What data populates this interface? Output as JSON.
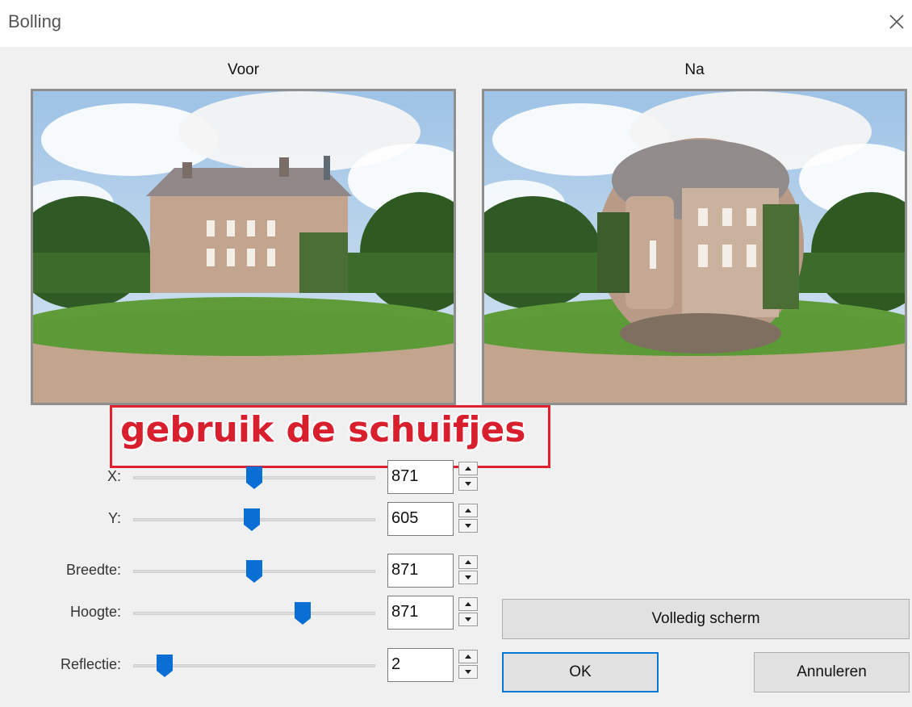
{
  "window": {
    "title": "Bolling",
    "close_icon": "close-icon"
  },
  "previews": {
    "before_label": "Voor",
    "after_label": "Na"
  },
  "annotation": {
    "text": "gebruik de schuifjes",
    "color": "#d81f2e"
  },
  "controls": [
    {
      "id": "x",
      "label": "X:",
      "value": "871",
      "slider_fraction": 0.5
    },
    {
      "id": "y",
      "label": "Y:",
      "value": "605",
      "slider_fraction": 0.49
    },
    {
      "id": "breedte",
      "label": "Breedte:",
      "value": "871",
      "slider_fraction": 0.5
    },
    {
      "id": "hoogte",
      "label": "Hoogte:",
      "value": "871",
      "slider_fraction": 0.7
    },
    {
      "id": "reflectie",
      "label": "Reflectie:",
      "value": "2",
      "slider_fraction": 0.13
    }
  ],
  "buttons": {
    "fullscreen": "Volledig scherm",
    "ok": "OK",
    "cancel": "Annuleren"
  },
  "colors": {
    "accent": "#0078d7",
    "slider_thumb": "#0a6fd4",
    "annotation_border": "#e0202e"
  }
}
